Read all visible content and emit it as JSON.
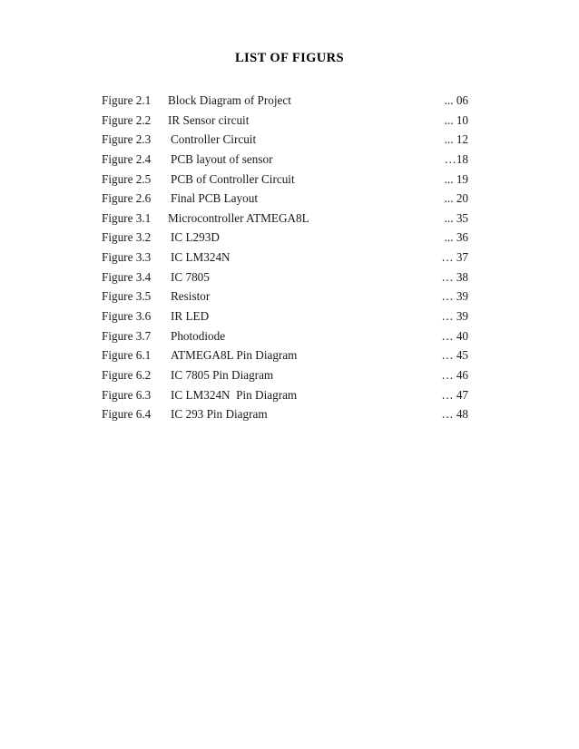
{
  "document": {
    "title": "LIST OF FIGURS"
  },
  "figures": [
    {
      "label": "Figure 2.1",
      "title": "Block Diagram of Project",
      "page": "... 06",
      "indent": false
    },
    {
      "label": "Figure 2.2",
      "title": "IR Sensor circuit",
      "page": "... 10",
      "indent": false
    },
    {
      "label": "Figure 2.3",
      "title": "Controller Circuit",
      "page": "... 12",
      "indent": true
    },
    {
      "label": "Figure 2.4",
      "title": "PCB layout of sensor",
      "page": "…18",
      "indent": true
    },
    {
      "label": "Figure 2.5",
      "title": "PCB of Controller Circuit",
      "page": "... 19",
      "indent": true
    },
    {
      "label": "Figure 2.6",
      "title": "Final PCB Layout",
      "page": "... 20",
      "indent": true
    },
    {
      "label": "Figure 3.1",
      "title": "Microcontroller ATMEGA8L",
      "page": "... 35",
      "indent": false
    },
    {
      "label": "Figure 3.2",
      "title": "IC L293D",
      "page": "... 36",
      "indent": true
    },
    {
      "label": "Figure 3.3",
      "title": "IC LM324N",
      "page": "… 37",
      "indent": true
    },
    {
      "label": "Figure 3.4",
      "title": "IC 7805",
      "page": "… 38",
      "indent": true
    },
    {
      "label": "Figure 3.5",
      "title": "Resistor",
      "page": "… 39",
      "indent": true
    },
    {
      "label": "Figure 3.6",
      "title": "IR LED",
      "page": "… 39",
      "indent": true
    },
    {
      "label": "Figure 3.7",
      "title": "Photodiode",
      "page": "… 40",
      "indent": true
    },
    {
      "label": "Figure 6.1",
      "title": "ATMEGA8L Pin Diagram",
      "page": "… 45",
      "indent": true
    },
    {
      "label": "Figure 6.2",
      "title": "IC 7805 Pin Diagram",
      "page": "… 46",
      "indent": true
    },
    {
      "label": "Figure 6.3",
      "title": "IC LM324N  Pin Diagram",
      "page": "… 47",
      "indent": true
    },
    {
      "label": "Figure 6.4",
      "title": "IC 293 Pin Diagram",
      "page": "… 48",
      "indent": true
    }
  ]
}
